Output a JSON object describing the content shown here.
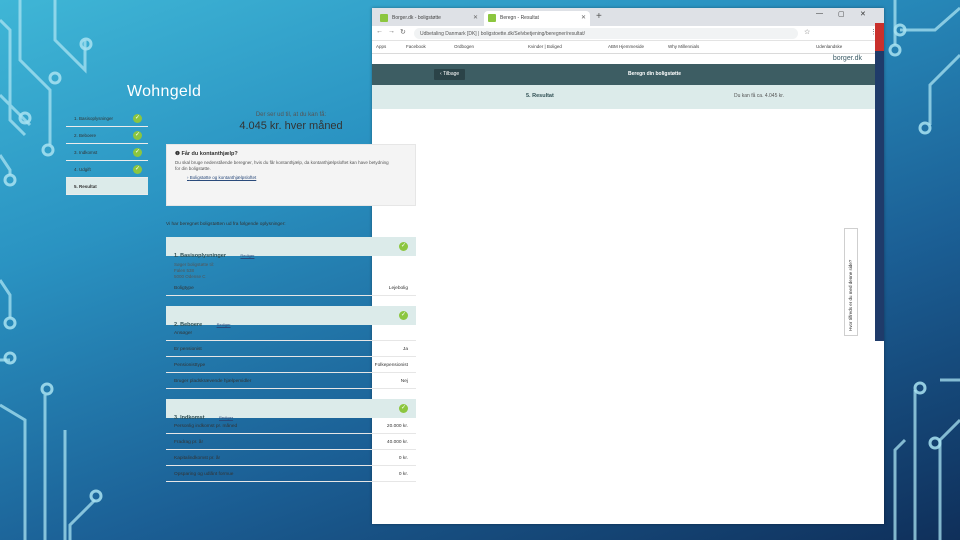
{
  "slide": {
    "title": "Wohngeld"
  },
  "browser": {
    "tabs": [
      {
        "label": "Borger.dk - boligstøtte"
      },
      {
        "label": "Beregn - Resultat"
      }
    ],
    "new_tab": "+",
    "window_controls": {
      "minimize": "—",
      "restore": "▢",
      "close": "✕"
    },
    "url": "Udbetaling Danmark [DK] | boligstoette.dk/Selvbetjening/beregner/resultat/",
    "bookmarks": [
      "Apps",
      "Facebook",
      "Ordbogen",
      "Kvinder | Boliged",
      "ABM Hjemmeside",
      "Why Millennials",
      "Udenlandske"
    ],
    "site_logo": "borger.dk"
  },
  "site": {
    "back_button": "‹ Tilbage",
    "title": "Beregn din boligstøtte",
    "step_title": "5. Resultat",
    "step_amount": "Du kan få ca. 4.045 kr."
  },
  "sidebar": {
    "items": [
      {
        "label": "1. Basisoplysninger",
        "done": true
      },
      {
        "label": "2. Beboere",
        "done": true
      },
      {
        "label": "3. Indkomst",
        "done": true
      },
      {
        "label": "4. Udgift",
        "done": true
      },
      {
        "label": "5. Resultat",
        "done": false
      }
    ]
  },
  "result": {
    "intro": "Der ser ud til, at du kan få:",
    "amount": "4.045 kr. hver måned"
  },
  "info_box": {
    "heading": "Får du kontanthjælp?",
    "text": "Du skal bruge nedenstående beregner, hvis du får kontanthjælp, da kontanthjælpsloftet kan have betydning for din boligstøtte.",
    "link": "Boligstøtte og kontanthjælpsloftet"
  },
  "summary_intro": "Vi har beregnet boligstøtten ud fra følgende oplysninger:",
  "sections": {
    "s1": {
      "title": "1. Basisoplysninger",
      "edit": "Rediger",
      "address": [
        "Søger boligstøtte til:",
        "Falen 538",
        "5000 Odense C"
      ],
      "rows": [
        {
          "label": "Boligtype",
          "value": "Lejebolig"
        }
      ]
    },
    "s2": {
      "title": "2. Beboere",
      "edit": "Rediger",
      "rows": [
        {
          "label": "Ansøger",
          "value": ""
        },
        {
          "label": "Er pensionist",
          "value": "Ja"
        },
        {
          "label": "Pensionisttype",
          "value": "Folkepensionist"
        },
        {
          "label": "Bruger pladskrævende hjælpemidler",
          "value": "Nej"
        }
      ]
    },
    "s3": {
      "title": "3. Indkomst",
      "edit": "Rediger",
      "rows": [
        {
          "label": "Personlig indkomst pr. måned",
          "value": "20.000 kr."
        },
        {
          "label": "Fradrag pr. år",
          "value": "40.000 kr."
        },
        {
          "label": "Kapitalindkomst pr. år",
          "value": "0 kr."
        },
        {
          "label": "Opsparing og udlånt formue",
          "value": "0 kr."
        }
      ]
    }
  },
  "feedback_tab": "Hvor tilfreds er du med denne side?"
}
